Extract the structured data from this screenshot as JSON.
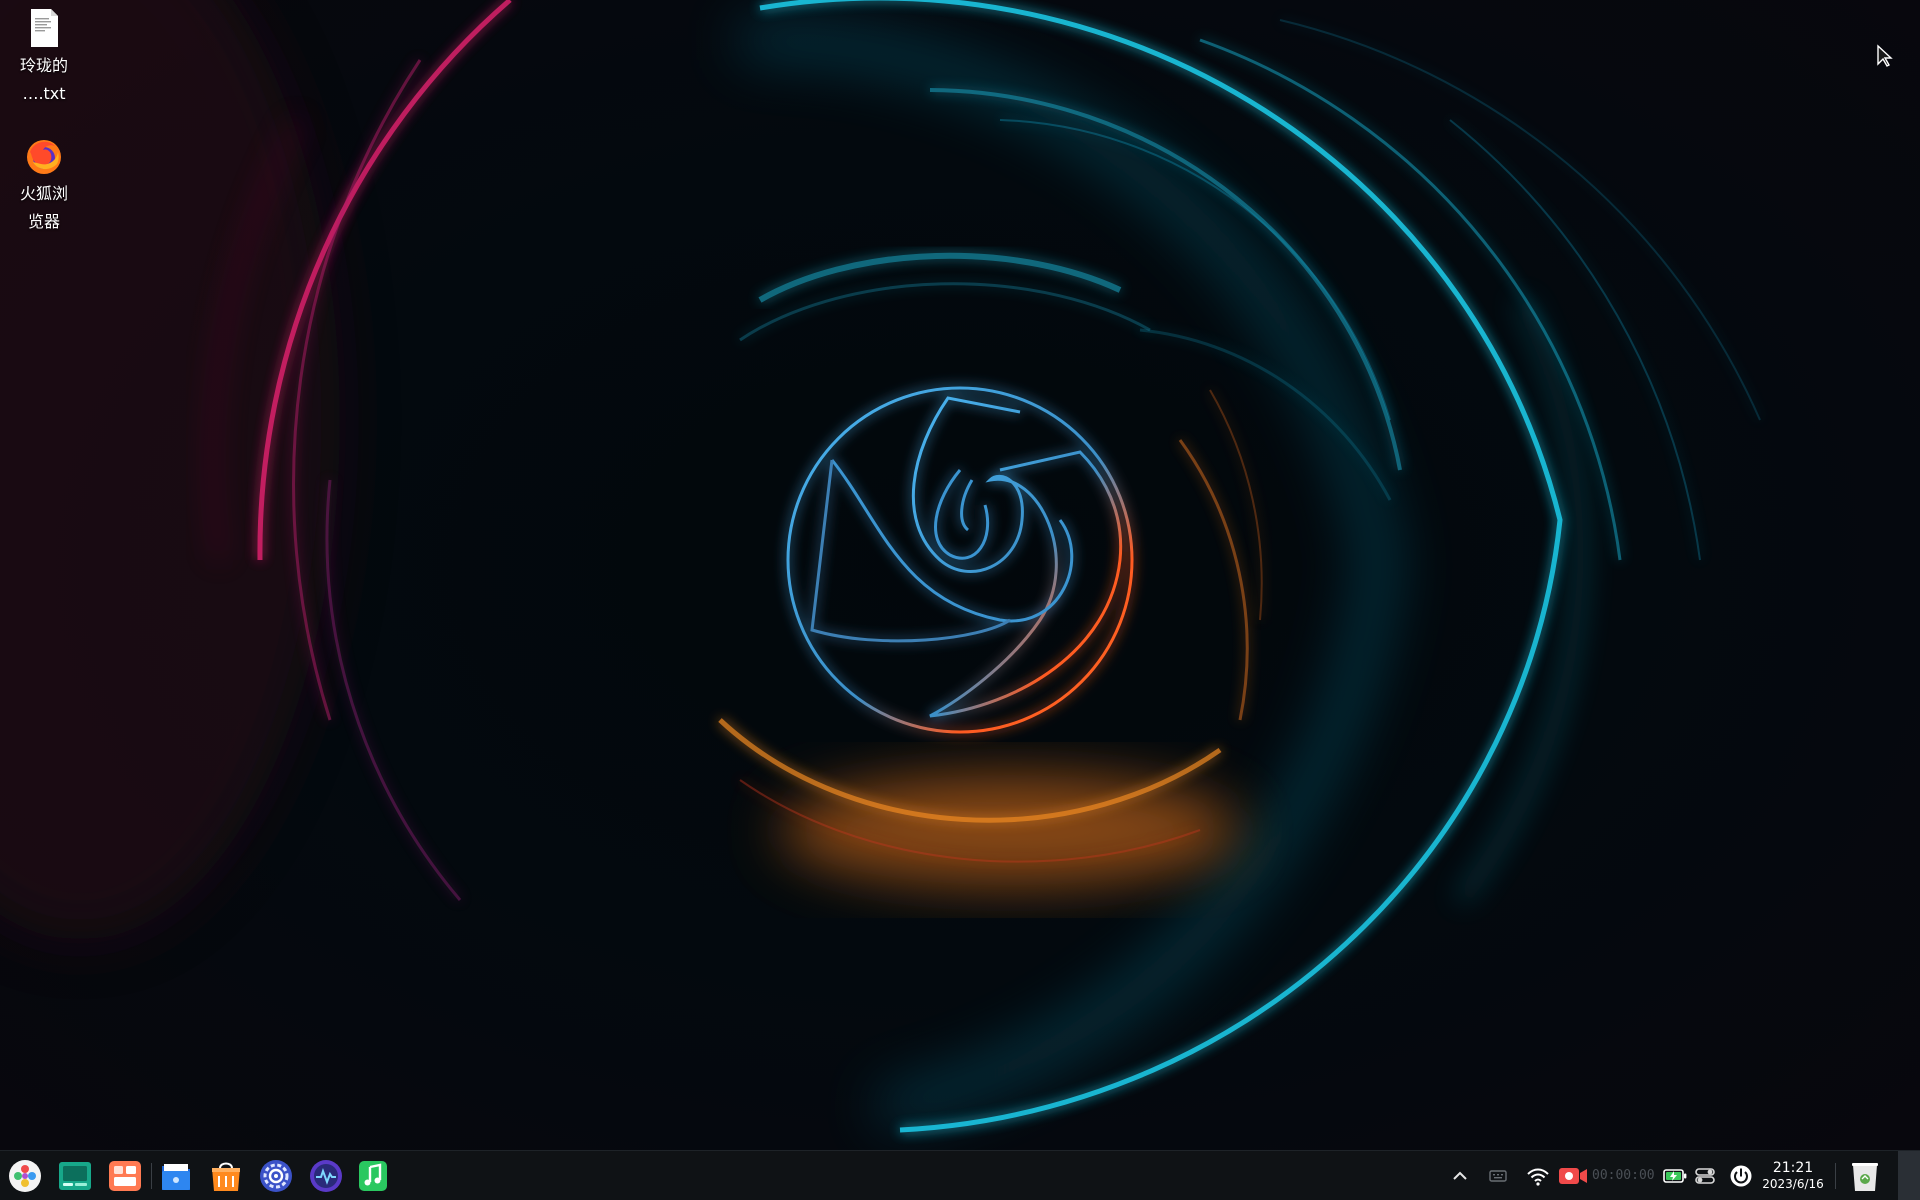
{
  "desktop": {
    "icons": [
      {
        "name": "text-file-icon",
        "label_line1": "玲珑的",
        "label_line2": "….txt"
      },
      {
        "name": "firefox-icon",
        "label_line1": "火狐浏",
        "label_line2": "览器"
      }
    ]
  },
  "taskbar": {
    "apps": [
      {
        "name": "launcher-icon"
      },
      {
        "name": "multitask-view-icon"
      },
      {
        "name": "workspace-icon"
      },
      {
        "name": "file-manager-icon"
      },
      {
        "name": "app-store-icon"
      },
      {
        "name": "control-center-icon"
      },
      {
        "name": "system-monitor-icon"
      },
      {
        "name": "music-icon"
      }
    ],
    "tray": {
      "recording_timer": "00:00:00",
      "clock_time": "21:21",
      "clock_date": "2023/6/16"
    }
  },
  "colors": {
    "taskbar_bg": "#0f1215",
    "ring_cyan": "#1ec8e6",
    "ring_magenta": "#e0246e",
    "ring_orange": "#f07a1e",
    "logo_blue": "#3aa8e8"
  }
}
